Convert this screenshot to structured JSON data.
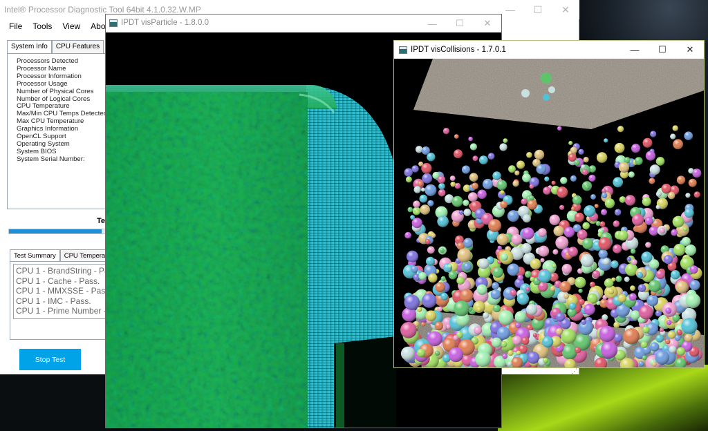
{
  "main_window": {
    "title": "Intel® Processor Diagnostic Tool 64bit 4.1.0.32.W.MP",
    "controls": {
      "minimize": "—",
      "maximize": "☐",
      "close": "✕"
    },
    "menu": [
      "File",
      "Tools",
      "View",
      "About"
    ],
    "tabs": [
      "System Info",
      "CPU Features"
    ],
    "sysinfo_labels": [
      "Processors Detected",
      "Processor Name",
      "Processor Information",
      "Processor Usage",
      "Number of Physical Cores",
      "Number of Logical Cores",
      "CPU Temperature",
      "Max/Min CPU Temps Detected",
      "Max CPU Temperature",
      "Graphics Information",
      "OpenCL Support",
      "Operating System",
      "System BIOS",
      "System Serial Number:"
    ],
    "progress_label": "Te",
    "progress_fraction": 0.85,
    "result_tabs": [
      "Test Summary",
      "CPU Temperature"
    ],
    "test_summary": [
      "CPU 1 - BrandString - Pass.",
      "CPU 1 - Cache - Pass.",
      "CPU 1 - MMXSSE - Pass.",
      "CPU 1 - IMC - Pass.",
      "CPU 1 - Prime Number - Pass."
    ],
    "stop_button": "Stop Test",
    "colors": {
      "accent": "#00a2e8",
      "progress": "#1e8fd6"
    }
  },
  "particle_window": {
    "title": "IPDT visParticle - 1.8.0.0",
    "controls": {
      "minimize": "—",
      "maximize": "☐",
      "close": "✕"
    },
    "colors": {
      "green": "#1fae4b",
      "cyan": "#2fb6c9"
    }
  },
  "collisions_window": {
    "title": "IPDT visCollisions - 1.7.0.1",
    "controls": {
      "minimize": "—",
      "maximize": "☐",
      "close": "✕"
    }
  }
}
